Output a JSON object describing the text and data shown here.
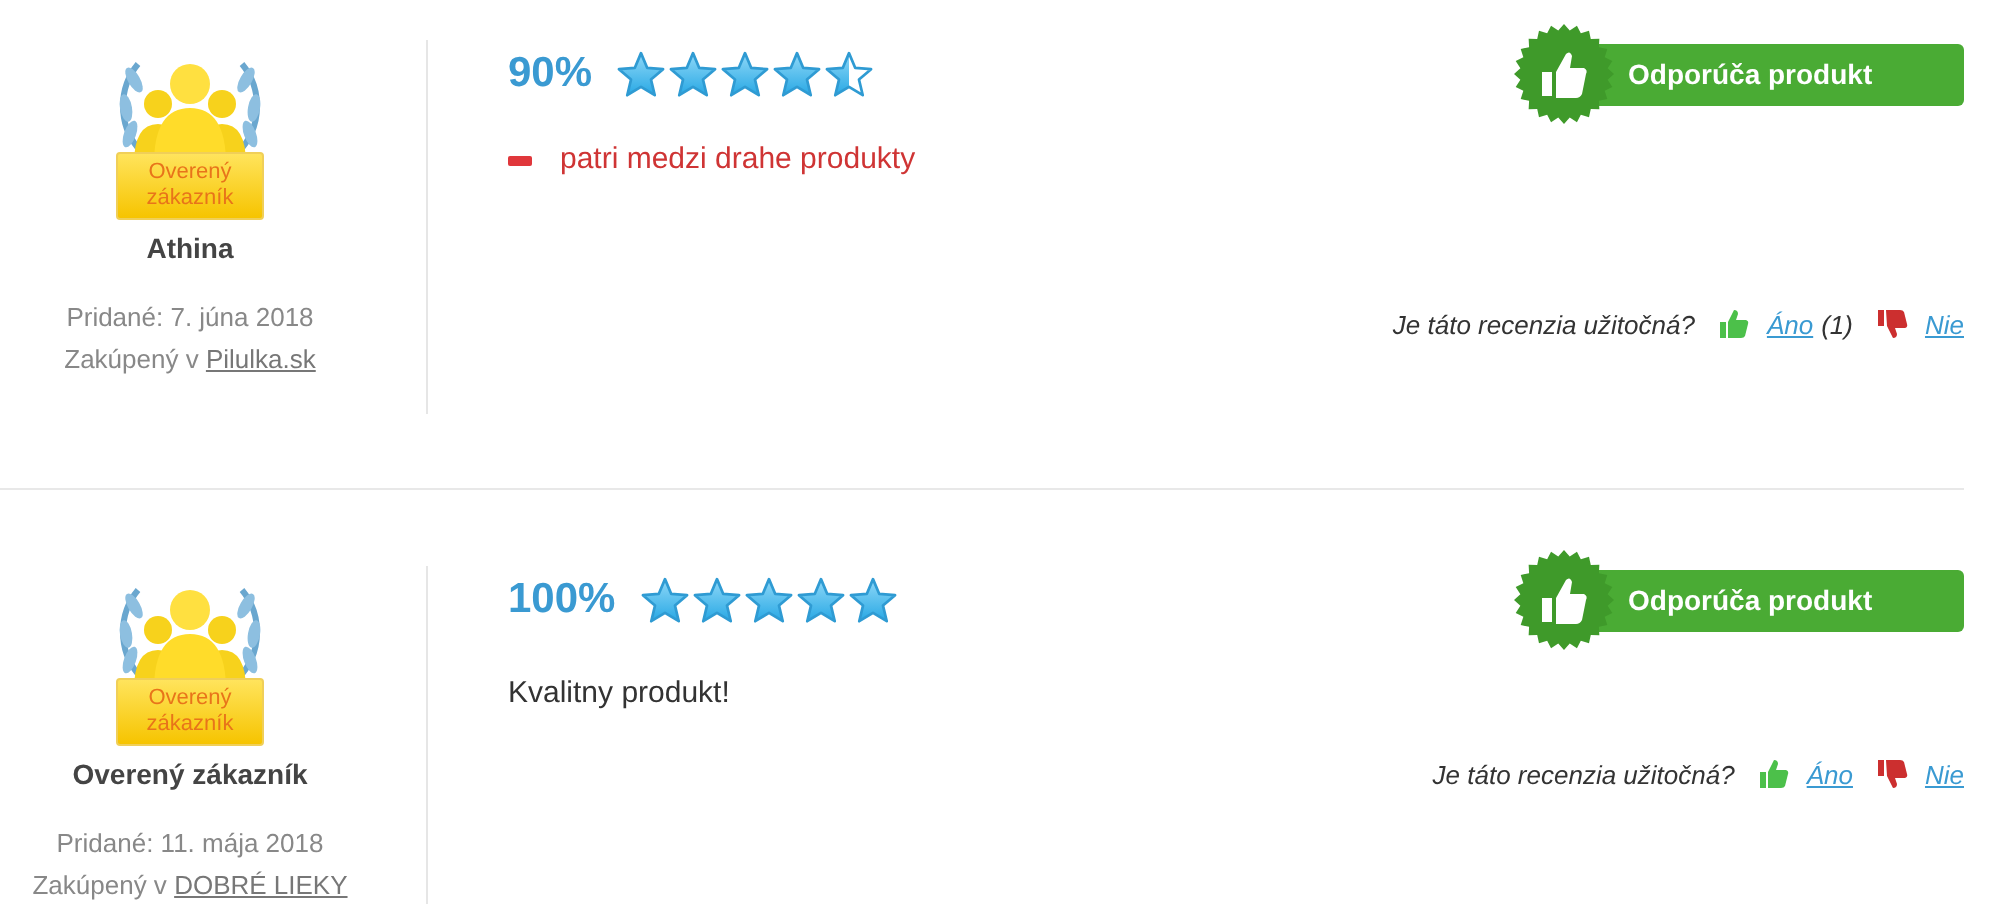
{
  "reviews": [
    {
      "badge_label": "Overený zákazník",
      "author": "Athina",
      "added": "Pridané: 7. júna 2018",
      "bought_prefix": "Zakúpený v",
      "shop": "Pilulka.sk",
      "percent": "90%",
      "stars": 4.5,
      "recommends": true,
      "recommend_label": "Odporúča produkt",
      "body": [
        {
          "kind": "con",
          "text": "patri medzi drahe produkty"
        }
      ],
      "helpful": {
        "question": "Je táto recenzia užitočná?",
        "yes": "Áno",
        "yes_count": "(1)",
        "no": "Nie"
      }
    },
    {
      "badge_label": "Overený zákazník",
      "author": "Overený zákazník",
      "added": "Pridané: 11. mája 2018",
      "bought_prefix": "Zakúpený v",
      "shop": "DOBRÉ LIEKY",
      "percent": "100%",
      "stars": 5,
      "recommends": true,
      "recommend_label": "Odporúča produkt",
      "body": [
        {
          "kind": "text",
          "text": "Kvalitny produkt!"
        }
      ],
      "helpful": {
        "question": "Je táto recenzia užitočná?",
        "yes": "Áno",
        "no": "Nie"
      }
    }
  ]
}
